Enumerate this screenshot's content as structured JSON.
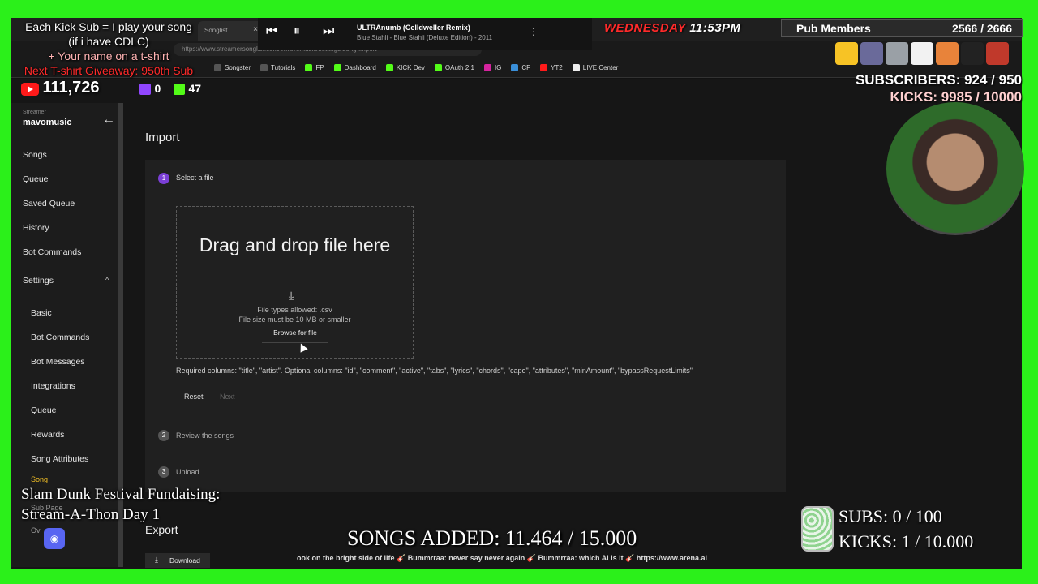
{
  "browser": {
    "tab_title": "Songlist",
    "address": "https://www.streamersonglist.com/t/mavomusic/settings/song-import",
    "bookmarks": [
      "Songster",
      "Tutorials",
      "FP",
      "Dashboard",
      "KICK Dev",
      "OAuth 2.1",
      "IG",
      "CF",
      "YT2",
      "LIVE Center"
    ]
  },
  "sidebar": {
    "streamer_label": "Streamer",
    "streamer_name": "mavomusic",
    "items": [
      "Songs",
      "Queue",
      "Saved Queue",
      "History",
      "Bot Commands",
      "Settings"
    ],
    "settings_items": [
      "Basic",
      "Bot Commands",
      "Bot Messages",
      "Integrations",
      "Queue",
      "Rewards",
      "Song Attributes",
      "Song",
      "Sub Page"
    ],
    "extra": "Ov"
  },
  "main": {
    "title": "Import",
    "steps": [
      {
        "num": "1",
        "label": "Select a file"
      },
      {
        "num": "2",
        "label": "Review the songs"
      },
      {
        "num": "3",
        "label": "Upload"
      }
    ],
    "dropzone": {
      "title": "Drag and drop file here",
      "types": "File types allowed: .csv",
      "size": "File size must be 10 MB or smaller",
      "browse": "Browse for file"
    },
    "required": "Required columns: \"title\", \"artist\". Optional columns: \"id\", \"comment\", \"active\", \"tabs\", \"lyrics\", \"chords\", \"capo\", \"attributes\", \"minAmount\", \"bypassRequestLimits\"",
    "reset": "Reset",
    "next": "Next",
    "export_title": "Export",
    "download": "Download"
  },
  "overlay": {
    "promo1": "Each Kick Sub = I play your song",
    "promo2": "(if i have CDLC)",
    "promo3": "+ Your name on a t-shirt",
    "promo4": "Next T-shirt Giveaway: 950th Sub",
    "youtube_count": "111,726",
    "twitch_count": "0",
    "kick_count": "47",
    "media_song": "ULTRAnumb (Celldweller Remix)",
    "media_artist": "Blue Stahli - Blue Stahli (Deluxe Edition) - 2011",
    "day": "WEDNESDAY",
    "time": "11:53PM",
    "pub_label": "Pub Members",
    "pub_value": "2566 / 2666",
    "subscribers": "SUBSCRIBERS: 924 / 950",
    "kicks": "KICKS: 9985 / 10000",
    "fund1": "Slam Dunk Festival Fundaising:",
    "fund2": "Stream-A-Thon Day 1",
    "songs_added": "SONGS ADDED: 11.464 / 15.000",
    "ticker": "ook on the bright side of life  🎸 Bummrraa: never say never again  🎸 Bummrraa: which AI is it  🎸 https://www.arena.ai",
    "subs_goal": "SUBS:  0 / 100",
    "kicks_goal": "KICKS: 1 / 10.000"
  },
  "colors": {
    "green_screen": "#2bf01a",
    "accent_purple": "#7b3fd6",
    "kick_green": "#53fc18",
    "alert_red": "#ff2a2a",
    "gold": "#f7c325"
  }
}
